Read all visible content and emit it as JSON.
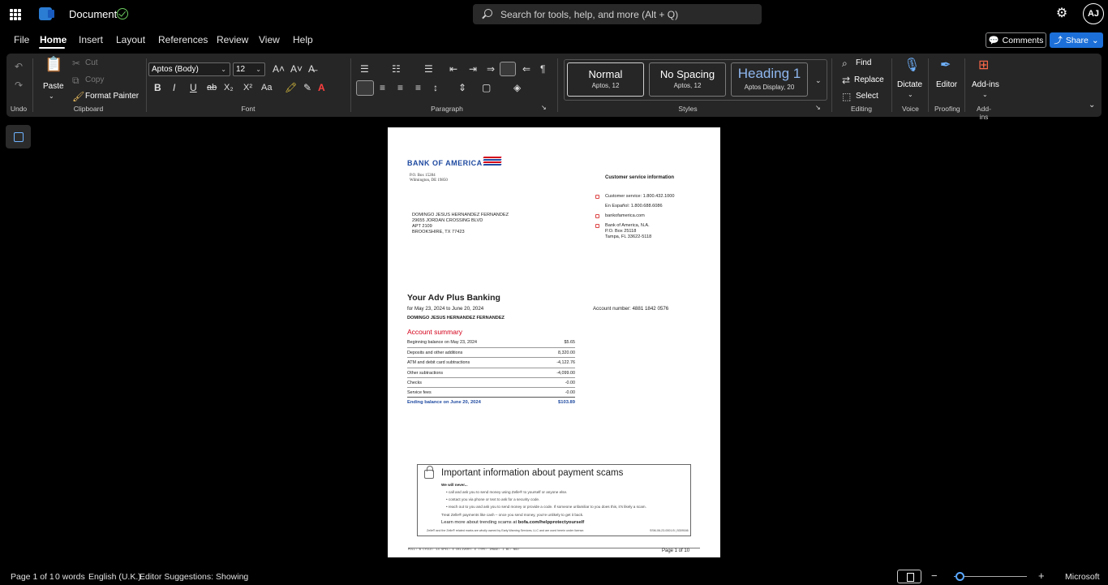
{
  "titlebar": {
    "title": "Document",
    "search_placeholder": "Search for tools, help, and more (Alt + Q)",
    "user_initials": "AJ",
    "icons": {
      "apps": "waffle-icon",
      "app": "word-logo-icon",
      "saved": "cloud-saved-icon",
      "settings": "gear-icon"
    }
  },
  "menu": {
    "items": [
      "File",
      "Home",
      "Insert",
      "Layout",
      "References",
      "Review",
      "View",
      "Help"
    ],
    "active": "Home",
    "comments_label": "Comments",
    "share_label": "Share"
  },
  "ribbon": {
    "undo": {
      "label": "Undo"
    },
    "clipboard": {
      "label": "Clipboard",
      "paste": "Paste",
      "cut": "Cut",
      "copy": "Copy",
      "format_painter": "Format Painter"
    },
    "font": {
      "label": "Font",
      "family": "Aptos (Body)",
      "size": "12",
      "bold": "B",
      "italic": "I",
      "underline": "U",
      "strike": "ab",
      "subscript": "X₂",
      "superscript": "X²",
      "case": "Aa"
    },
    "paragraph": {
      "label": "Paragraph"
    },
    "styles": {
      "label": "Styles",
      "items": [
        {
          "name": "Normal",
          "sub": "Aptos, 12"
        },
        {
          "name": "No Spacing",
          "sub": "Aptos, 12"
        },
        {
          "name": "Heading 1",
          "sub": "Aptos Display, 20"
        }
      ]
    },
    "editing": {
      "label": "Editing",
      "find": "Find",
      "replace": "Replace",
      "select": "Select"
    },
    "voice": {
      "label": "Voice",
      "dictate": "Dictate"
    },
    "proofing": {
      "label": "Proofing",
      "editor": "Editor"
    },
    "addins": {
      "label": "Add-ins",
      "addins": "Add-ins"
    },
    "accent": "#1c6fd8"
  },
  "document": {
    "logo_text": "BANK OF AMERICA",
    "return_address": [
      "P.O. Box 15284",
      "Wilmington, DE 19850"
    ],
    "recipient": [
      "DOMINGO JESUS HERNANDEZ FERNANDEZ",
      "29655 JORDAN CROSSING BLVD",
      "APT 2109",
      "BROOKSHIRE, TX 77423"
    ],
    "cs_title": "Customer service information",
    "cs_phone": "Customer service: 1.800.432.1000",
    "cs_spanish": "En Español: 1.800.688.6086",
    "cs_web": "bankofamerica.com",
    "cs_address": [
      "Bank of America, N.A.",
      "P.O. Box 25118",
      "Tampa, FL 33622-5118"
    ],
    "product": "Your Adv Plus Banking",
    "period": "for May 23, 2024 to June 20, 2024",
    "account_number": "Account number: 4881 1842 0576",
    "owner": "DOMINGO JESUS HERNANDEZ FERNANDEZ",
    "summary_title": "Account summary",
    "summary_rows": [
      {
        "label": "Beginning balance on May 23, 2024",
        "value": "$5.65"
      },
      {
        "label": "Deposits and other additions",
        "value": "8,320.00"
      },
      {
        "label": "ATM and debit card subtractions",
        "value": "-4,122.76"
      },
      {
        "label": "Other subtractions",
        "value": "-4,099.00"
      },
      {
        "label": "Checks",
        "value": "-0.00"
      },
      {
        "label": "Service fees",
        "value": "-0.00"
      }
    ],
    "summary_total": {
      "label": "Ending balance on June 20, 2024",
      "value": "$103.89"
    },
    "scam_title": "Important information about payment scams",
    "scam_we_will_never": "We will never...",
    "scam_bullets": [
      "call and ask you to send money using Zelle® to yourself or anyone else.",
      "contact you via phone or text to ask for a security code.",
      "reach out to you and ask you to send money or provide a code. If someone unfamiliar to you does this, it's likely a scam."
    ],
    "scam_treat": "Treat Zelle® payments like cash – once you send money, you're unlikely to get it back.",
    "scam_learn_prefix": "Learn more about trending scams at ",
    "scam_learn_link": "bofa.com/helpprotectyourself",
    "scam_footnote": "Zelle® and the Zelle® related marks are wholly owned by Early Warning Services, LLC and are used herein under license.",
    "scam_code": "SSM-06-23-0001.B | 5309166",
    "footer_code": "PULL: B CYCLE: 14 SPEC: E DELIVERY: E TYPE: IMAGE: I BC: NGU",
    "footer_page": "Page 1 of 10"
  },
  "status": {
    "page": "Page 1 of 1",
    "words": "0 words",
    "language": "English (U.K.)",
    "editor": "Editor Suggestions: Showing",
    "brand": "Microsoft",
    "zoom_fraction": 0.08
  }
}
